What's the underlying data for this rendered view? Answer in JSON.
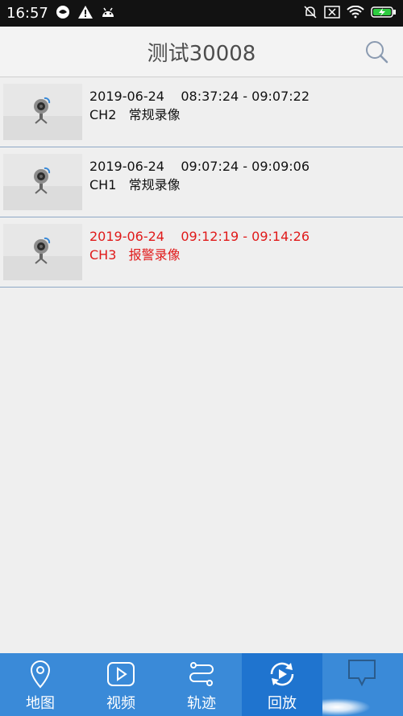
{
  "status_bar": {
    "time": "16:57",
    "left_icons": [
      "cloud-icon",
      "warning-icon",
      "android-icon"
    ],
    "right_icons": [
      "mute-bell-icon",
      "close-box-icon",
      "wifi-icon",
      "battery-charging-icon"
    ]
  },
  "header": {
    "title": "测试30008",
    "search_icon": "search-icon"
  },
  "recordings": [
    {
      "date": "2019-06-24",
      "time_range": "08:37:24 - 09:07:22",
      "channel": "CH2",
      "type": "常规录像",
      "alarm": false
    },
    {
      "date": "2019-06-24",
      "time_range": "09:07:24 - 09:09:06",
      "channel": "CH1",
      "type": "常规录像",
      "alarm": false
    },
    {
      "date": "2019-06-24",
      "time_range": "09:12:19 - 09:14:26",
      "channel": "CH3",
      "type": "报警录像",
      "alarm": true
    }
  ],
  "tabs": [
    {
      "label": "地图",
      "icon": "map-pin-icon"
    },
    {
      "label": "视频",
      "icon": "video-play-icon"
    },
    {
      "label": "轨迹",
      "icon": "route-icon"
    },
    {
      "label": "回放",
      "icon": "playback-icon",
      "active": true
    },
    {
      "label": "",
      "icon": "message-icon"
    }
  ],
  "colors": {
    "tab_bar": "#3a8ad8",
    "tab_active": "#1f74cf",
    "alarm_text": "#e01a1a",
    "divider": "#8ea8c6"
  }
}
